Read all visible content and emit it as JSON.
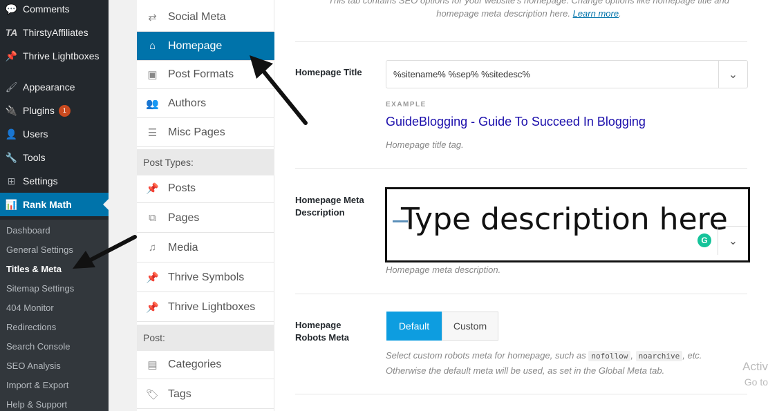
{
  "wp_menu": {
    "items": [
      {
        "icon": "comment-icon",
        "glyph": "💬",
        "label": "Comments"
      },
      {
        "icon": "thirstyaffiliates-icon",
        "glyph": "TA",
        "label": "ThirstyAffiliates"
      },
      {
        "icon": "pin-icon",
        "glyph": "📌",
        "label": "Thrive Lightboxes"
      },
      {
        "icon": "brush-icon",
        "glyph": "🖌",
        "label": "Appearance"
      },
      {
        "icon": "plug-icon",
        "glyph": "🔌",
        "label": "Plugins",
        "badge": "1"
      },
      {
        "icon": "user-icon",
        "glyph": "👤",
        "label": "Users"
      },
      {
        "icon": "wrench-icon",
        "glyph": "🔧",
        "label": "Tools"
      },
      {
        "icon": "settings-icon",
        "glyph": "⊞",
        "label": "Settings"
      },
      {
        "icon": "chart-icon",
        "glyph": "📊",
        "label": "Rank Math"
      }
    ],
    "submenu": [
      "Dashboard",
      "General Settings",
      "Titles & Meta",
      "Sitemap Settings",
      "404 Monitor",
      "Redirections",
      "Search Console",
      "SEO Analysis",
      "Import & Export",
      "Help & Support"
    ]
  },
  "tabs": {
    "items": [
      {
        "icon": "retweet-icon",
        "glyph": "⇄",
        "label": "Social Meta"
      },
      {
        "icon": "home-icon",
        "glyph": "⌂",
        "label": "Homepage"
      },
      {
        "icon": "image-icon",
        "glyph": "▣",
        "label": "Post Formats"
      },
      {
        "icon": "users-icon",
        "glyph": "👥",
        "label": "Authors"
      },
      {
        "icon": "sliders-icon",
        "glyph": "☰",
        "label": "Misc Pages"
      },
      {
        "icon": "pin-icon",
        "glyph": "📌",
        "label": "Posts"
      },
      {
        "icon": "pages-icon",
        "glyph": "⧉",
        "label": "Pages"
      },
      {
        "icon": "media-icon",
        "glyph": "♫",
        "label": "Media"
      },
      {
        "icon": "pin-icon",
        "glyph": "📌",
        "label": "Thrive Symbols"
      },
      {
        "icon": "pin-icon",
        "glyph": "📌",
        "label": "Thrive Lightboxes"
      },
      {
        "icon": "folder-icon",
        "glyph": "▤",
        "label": "Categories"
      },
      {
        "icon": "tag-icon",
        "glyph": "🏷",
        "label": "Tags"
      }
    ],
    "group_post_types": "Post Types:",
    "group_post": "Post:"
  },
  "main": {
    "intro_line1": "This tab contains SEO options for your website's homepage. Change options like homepage title and",
    "intro_line2": "homepage meta description here.",
    "intro_link": "Learn more",
    "intro_end": ".",
    "title_label": "Homepage Title",
    "title_value": "%sitename% %sep% %sitedesc%",
    "example_label": "EXAMPLE",
    "example_site": "GuideBlogging",
    "example_sep": " - ",
    "example_desc": "Guide To Succeed In Blogging",
    "title_hint": "Homepage title tag.",
    "desc_label_1": "Homepage Meta",
    "desc_label_2": "Description",
    "desc_placeholder": "Type description here",
    "grammarly": "G",
    "desc_hint": "Homepage meta description.",
    "robots_label_1": "Homepage",
    "robots_label_2": "Robots Meta",
    "robots_default": "Default",
    "robots_custom": "Custom",
    "robots_hint_1": "Select custom robots meta for homepage, such as",
    "robots_code_1": "nofollow",
    "robots_sep": ",",
    "robots_code_2": "noarchive",
    "robots_hint_2": ", etc.",
    "robots_hint_3": "Otherwise the default meta will be used, as set in the Global Meta tab."
  },
  "watermark": {
    "line1": "Activ",
    "line2": "Go to"
  },
  "colors": {
    "wp_active": "#0073aa",
    "toggle_on": "#0d9de0",
    "example_link": "#1a0dab",
    "badge": "#ca4a1f"
  }
}
